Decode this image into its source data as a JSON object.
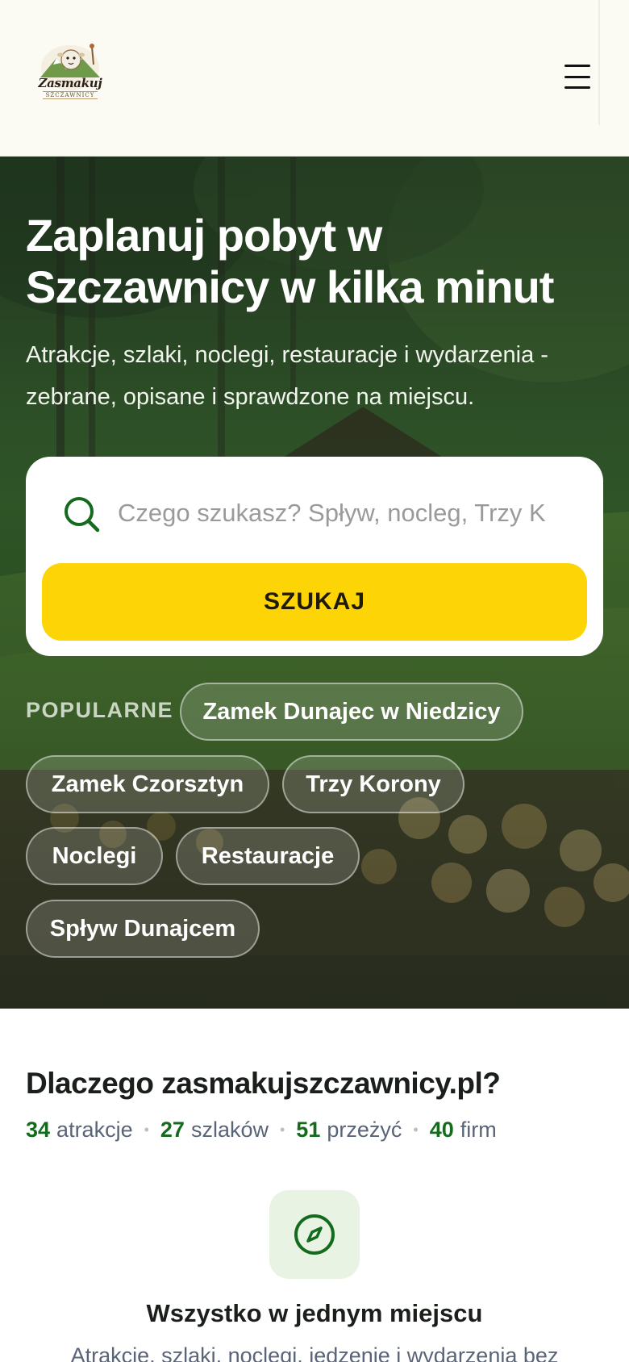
{
  "header": {
    "logo_text": "Zasmakuj",
    "logo_subtext": "SZCZAWNICY",
    "menu_icon": "hamburger-menu-icon"
  },
  "hero": {
    "title": "Zaplanuj pobyt w Szczawnicy w kilka minut",
    "subtitle": "Atrakcje, szlaki, noclegi, restauracje i wydarzenia - zebrane, opisane i sprawdzone na miejscu.",
    "search": {
      "placeholder": "Czego szukasz? Spływ, nocleg, Trzy K",
      "value": "",
      "button_label": "SZUKAJ",
      "icon": "search-icon"
    },
    "popular_label": "POPULARNE",
    "chips": [
      "Zamek Dunajec w Niedzicy",
      "Zamek Czorsztyn",
      "Trzy Korony",
      "Noclegi",
      "Restauracje",
      "Spływ Dunajcem"
    ]
  },
  "why": {
    "title": "Dlaczego zasmakujszczawnicy.pl?",
    "stats": [
      {
        "value": "34",
        "label": "atrakcje"
      },
      {
        "value": "27",
        "label": "szlaków"
      },
      {
        "value": "51",
        "label": "przeżyć"
      },
      {
        "value": "40",
        "label": "firm"
      }
    ],
    "feature": {
      "icon": "compass-icon",
      "title": "Wszystko w jednym miejscu",
      "description": "Atrakcje, szlaki, noclegi, jedzenie i wydarzenia bez"
    }
  },
  "colors": {
    "accent_green": "#146b1e",
    "button_yellow": "#fdd406",
    "header_bg": "#fbfaf3"
  }
}
